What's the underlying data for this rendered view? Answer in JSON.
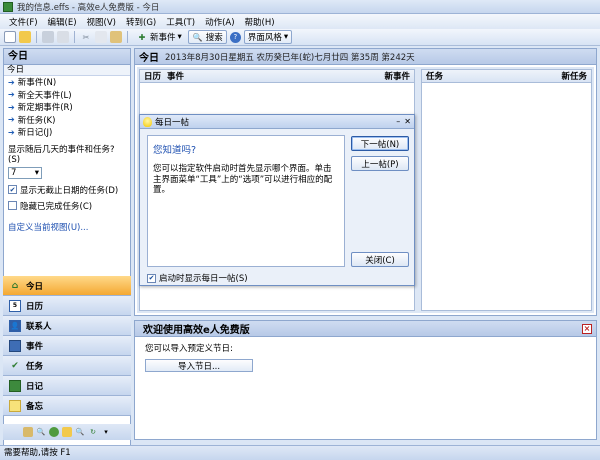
{
  "window": {
    "title": "我的信息.effs - 高效e人免费版 - 今日"
  },
  "menu": [
    "文件(F)",
    "编辑(E)",
    "视图(V)",
    "转到(G)",
    "工具(T)",
    "动作(A)",
    "帮助(H)"
  ],
  "toolbar": {
    "new_event": "新事件",
    "search": "搜索",
    "style": "界面风格"
  },
  "left": {
    "header": "今日",
    "section": "今日",
    "links": [
      "新事件(N)",
      "新全天事件(L)",
      "新定期事件(R)",
      "新任务(K)",
      "新日记(J)"
    ],
    "days_label": "显示随后几天的事件和任务?(S)",
    "days_value": "7",
    "check1": "显示无截止日期的任务(D)",
    "check2": "隐藏已完成任务(C)",
    "custom": "自定义当前视图(U)..."
  },
  "nav": [
    "今日",
    "日历",
    "联系人",
    "事件",
    "任务",
    "日记",
    "备忘"
  ],
  "main": {
    "title": "今日",
    "date": "2013年8月30日星期五  农历癸巳年(蛇)七月廿四  第35周 第242天",
    "col1": {
      "a": "日历",
      "b": "事件",
      "right": "新事件"
    },
    "col2": {
      "a": "任务",
      "right": "新任务"
    }
  },
  "welcome": {
    "title": "欢迎使用高效e人免费版",
    "msg": "您可以导入预定义节日:",
    "import": "导入节日..."
  },
  "dialog": {
    "title": "每日一帖",
    "q": "您知道吗?",
    "text": "您可以指定软件启动时首先显示哪个界面。单击主界面菜单“工具”上的“选项”可以进行相应的配置。",
    "next": "下一帖(N)",
    "prev": "上一帖(P)",
    "close": "关闭(C)",
    "startup": "启动时显示每日一帖(S)"
  },
  "status": "需要帮助,请按 F1"
}
